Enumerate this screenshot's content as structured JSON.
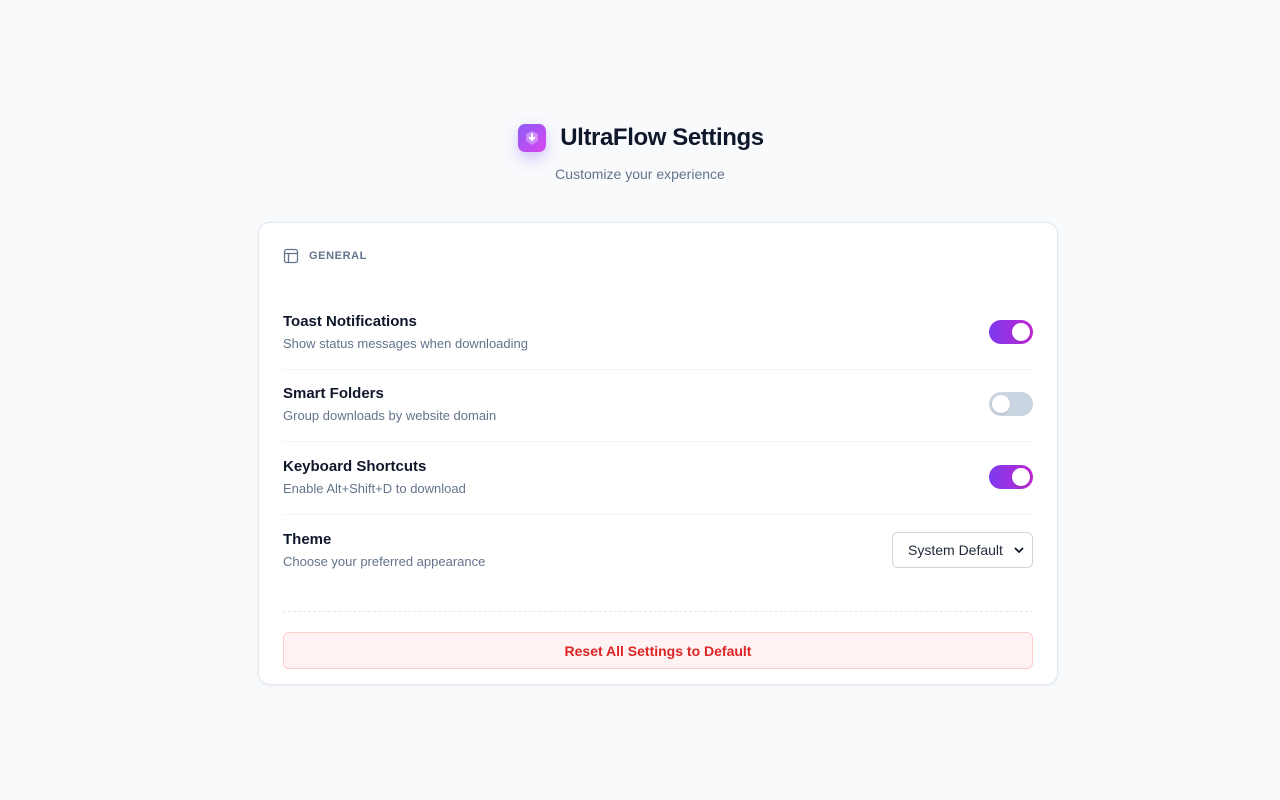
{
  "header": {
    "title": "UltraFlow Settings",
    "subtitle": "Customize your experience",
    "logo_icon": "download-arrow-icon"
  },
  "section": {
    "label": "GENERAL",
    "icon": "layout-icon"
  },
  "settings": [
    {
      "title": "Toast Notifications",
      "description": "Show status messages when downloading",
      "enabled": true
    },
    {
      "title": "Smart Folders",
      "description": "Group downloads by website domain",
      "enabled": false
    },
    {
      "title": "Keyboard Shortcuts",
      "description": "Enable Alt+Shift+D to download",
      "enabled": true
    }
  ],
  "theme": {
    "title": "Theme",
    "description": "Choose your preferred appearance",
    "selected": "System Default"
  },
  "reset_label": "Reset All Settings to Default",
  "colors": {
    "accent_start": "#7c3aed",
    "accent_end": "#c026d3",
    "danger": "#dc2626",
    "background": "#f8fafc"
  }
}
